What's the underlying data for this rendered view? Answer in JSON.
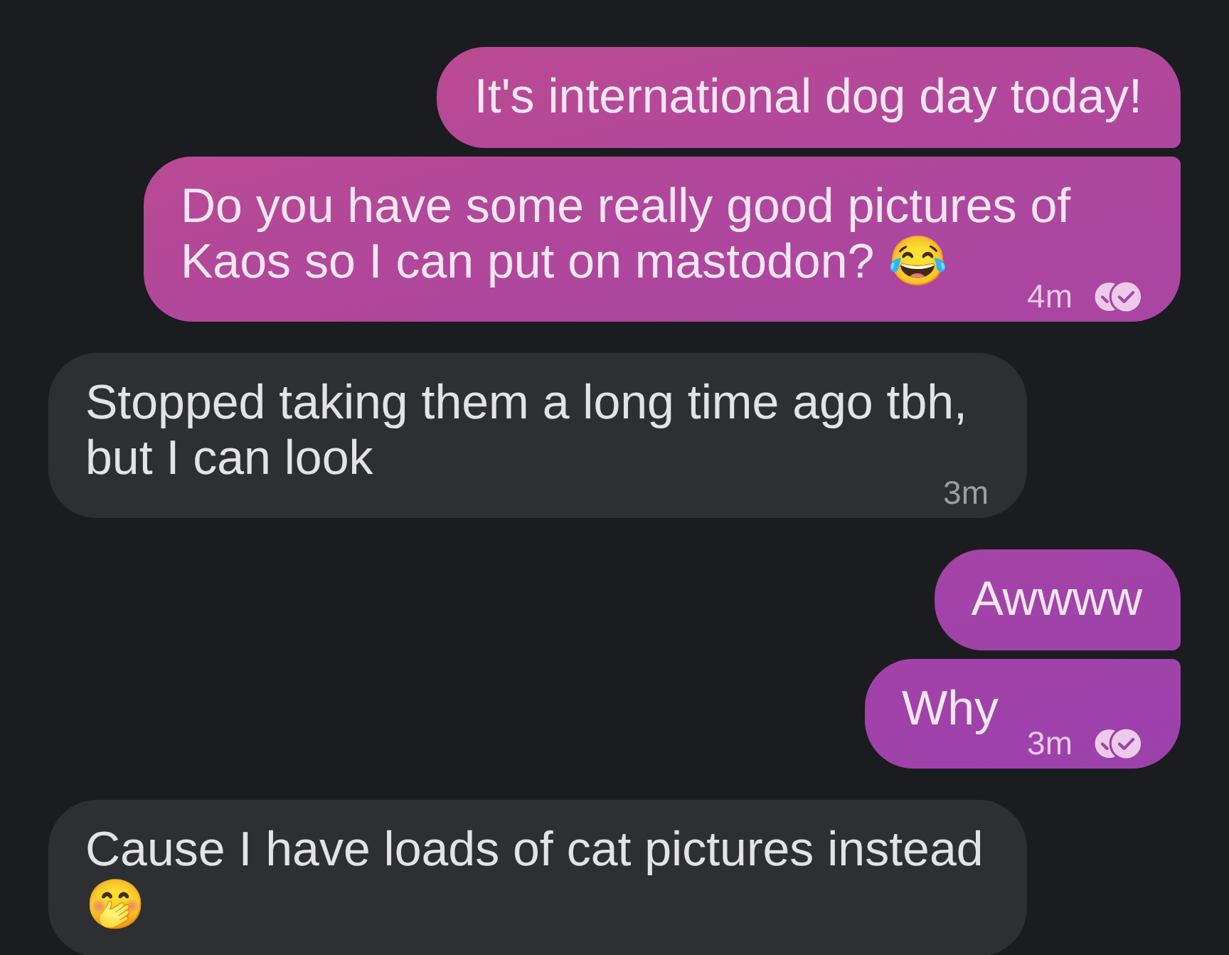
{
  "messages": [
    {
      "outgoing": true,
      "text": "It's international dog day today!"
    },
    {
      "outgoing": true,
      "text": "Do you have some really good pictures of Kaos so I can put on mastodon? 😂",
      "time": "4m",
      "read": true
    },
    {
      "outgoing": false,
      "text": "Stopped taking them a long time ago tbh, but I can look",
      "time": "3m"
    },
    {
      "outgoing": true,
      "text": "Awwww"
    },
    {
      "outgoing": true,
      "text": "Why",
      "time": "3m",
      "read": true
    },
    {
      "outgoing": false,
      "text": "Cause I have loads of cat pictures instead 🤭"
    }
  ]
}
